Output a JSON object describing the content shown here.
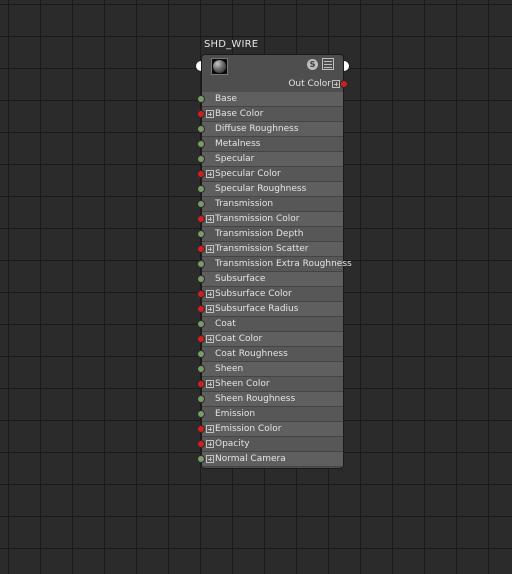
{
  "node": {
    "title": "SHD_WIRE",
    "swatch_icon": "sphere-swatch-icon",
    "shader_badge": "S",
    "output": {
      "label": "Out Color",
      "type": "color",
      "expandable": true
    }
  },
  "port_colors": {
    "float": "#7a9a6a",
    "color": "#d21e1e",
    "main": "#ffffff"
  },
  "attributes": [
    {
      "label": "Base",
      "type": "float",
      "expandable": false
    },
    {
      "label": "Base Color",
      "type": "color",
      "expandable": true
    },
    {
      "label": "Diffuse Roughness",
      "type": "float",
      "expandable": false
    },
    {
      "label": "Metalness",
      "type": "float",
      "expandable": false
    },
    {
      "label": "Specular",
      "type": "float",
      "expandable": false
    },
    {
      "label": "Specular Color",
      "type": "color",
      "expandable": true
    },
    {
      "label": "Specular Roughness",
      "type": "float",
      "expandable": false
    },
    {
      "label": "Transmission",
      "type": "float",
      "expandable": false
    },
    {
      "label": "Transmission Color",
      "type": "color",
      "expandable": true
    },
    {
      "label": "Transmission Depth",
      "type": "float",
      "expandable": false
    },
    {
      "label": "Transmission Scatter",
      "type": "color",
      "expandable": true
    },
    {
      "label": "Transmission Extra Roughness",
      "type": "float",
      "expandable": false
    },
    {
      "label": "Subsurface",
      "type": "float",
      "expandable": false
    },
    {
      "label": "Subsurface Color",
      "type": "color",
      "expandable": true
    },
    {
      "label": "Subsurface Radius",
      "type": "color",
      "expandable": true
    },
    {
      "label": "Coat",
      "type": "float",
      "expandable": false
    },
    {
      "label": "Coat Color",
      "type": "color",
      "expandable": true
    },
    {
      "label": "Coat Roughness",
      "type": "float",
      "expandable": false
    },
    {
      "label": "Sheen",
      "type": "float",
      "expandable": false
    },
    {
      "label": "Sheen Color",
      "type": "color",
      "expandable": true
    },
    {
      "label": "Sheen Roughness",
      "type": "float",
      "expandable": false
    },
    {
      "label": "Emission",
      "type": "float",
      "expandable": false
    },
    {
      "label": "Emission Color",
      "type": "color",
      "expandable": true
    },
    {
      "label": "Opacity",
      "type": "color",
      "expandable": true
    },
    {
      "label": "Normal Camera",
      "type": "float",
      "expandable": true
    }
  ]
}
